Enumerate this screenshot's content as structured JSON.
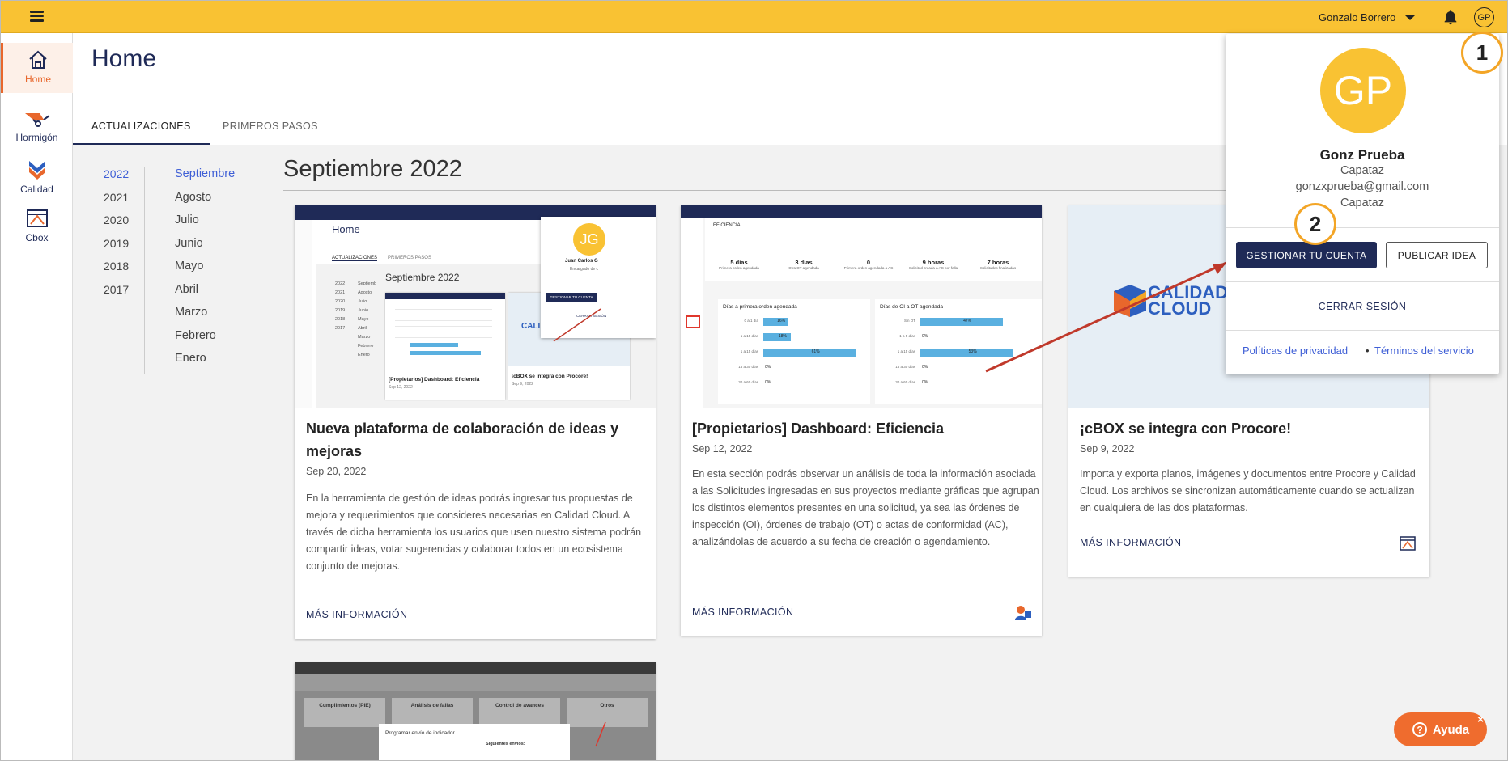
{
  "topbar": {
    "user_name": "Gonzalo Borrero",
    "avatar_initials": "GP",
    "accent": "#f9c233"
  },
  "sidebar": {
    "items": [
      {
        "label": "Home"
      },
      {
        "label": "Hormigón"
      },
      {
        "label": "Calidad"
      },
      {
        "label": "Cbox"
      }
    ]
  },
  "page": {
    "title": "Home",
    "tabs": [
      "ACTUALIZACIONES",
      "PRIMEROS PASOS"
    ]
  },
  "filters": {
    "years": [
      "2022",
      "2021",
      "2020",
      "2019",
      "2018",
      "2017"
    ],
    "months": [
      "Septiembre",
      "Agosto",
      "Julio",
      "Junio",
      "Mayo",
      "Abril",
      "Marzo",
      "Febrero",
      "Enero"
    ]
  },
  "section_title": "Septiembre 2022",
  "cards": [
    {
      "title": "Nueva plataforma de colaboración de ideas y mejoras",
      "date": "Sep 20, 2022",
      "body": "En la herramienta de gestión de ideas podrás ingresar tus propuestas de mejora y requerimientos que consideres necesarias en Calidad Cloud. A través de dicha herramienta los usuarios que usen nuestro sistema podrán compartir ideas, votar sugerencias y colaborar todos en un ecosistema conjunto de mejoras.",
      "more": "MÁS INFORMACIÓN"
    },
    {
      "title": "[Propietarios] Dashboard: Eficiencia",
      "date": "Sep 12, 2022",
      "body": "En esta sección podrás observar un análisis de toda la información asociada a las Solicitudes ingresadas en sus proyectos mediante gráficas que agrupan los distintos elementos presentes en una solicitud, ya sea las órdenes de inspección (OI), órdenes de trabajo (OT) o actas de conformidad (AC), analizándolas de acuerdo a su fecha de creación o agendamiento.",
      "more": "MÁS INFORMACIÓN"
    },
    {
      "title": "¡cBOX se integra con Procore!",
      "date": "Sep 9, 2022",
      "body": "Importa y exporta planos, imágenes y documentos entre Procore y Calidad Cloud. Los archivos se sincronizan automáticamente cuando se actualizan en cualquiera de las dos plataformas.",
      "more": "MÁS INFORMACIÓN"
    }
  ],
  "thumbs": {
    "t1": {
      "title": "Home",
      "tab1": "ACTUALIZACIONES",
      "tab2": "PRIMEROS PASOS",
      "section": "Septiembre 2022",
      "avatar": "JG",
      "user": "Juan Carlos G",
      "role": "Encargado de c",
      "manage": "GESTIONAR TU CUENTA",
      "logout": "CERRAR SESIÓN",
      "card1": "[Propietarios] Dashboard: Eficiencia",
      "card1_date": "Sep 12, 2022",
      "card2": "¡cBOX se integra con Procore!",
      "card2_date": "Sep 9, 2022",
      "logo": "CALIDAD CLOUD",
      "years": [
        "2022",
        "2021",
        "2020",
        "2019",
        "2018",
        "2017"
      ],
      "months": [
        "Septiemb",
        "Agosto",
        "Julio",
        "Junio",
        "Mayo",
        "Abril",
        "Marzo",
        "Febrero",
        "Enero"
      ]
    },
    "t2": {
      "tab": "EFICIENCIA",
      "kpis": [
        {
          "v": "5 días",
          "l": "Primera orden agendada"
        },
        {
          "v": "3 días",
          "l": "Otra OT agendada"
        },
        {
          "v": "0",
          "l": "Primera orden agendada a AC"
        },
        {
          "v": "9 horas",
          "l": "Solicitud creada a AC por falla"
        },
        {
          "v": "7 horas",
          "l": "Solicitudes finalizadas"
        }
      ],
      "chart1": "Días a primera orden agendada",
      "chart2": "Días de OI a OT agendada",
      "bars1": [
        {
          "l": "0 a 1 día",
          "p": "16%",
          "v": 16
        },
        {
          "l": "1 a 15 días",
          "p": "18%",
          "v": 18
        },
        {
          "l": "1 a 15 días",
          "p": "61%",
          "v": 61
        },
        {
          "l": "15 a 30 días",
          "p": "0%",
          "v": 0
        },
        {
          "l": "30 a 60 días",
          "p": "0%",
          "v": 0
        }
      ],
      "bars2": [
        {
          "l": "Sin OT",
          "p": "47%",
          "v": 47
        },
        {
          "l": "1 a 5 días",
          "p": "0%",
          "v": 0
        },
        {
          "l": "1 a 15 días",
          "p": "53%",
          "v": 53
        },
        {
          "l": "15 a 30 días",
          "p": "0%",
          "v": 0
        },
        {
          "l": "30 a 60 días",
          "p": "0%",
          "v": 0
        }
      ]
    },
    "t3": {
      "logo1": "CALIDAD",
      "logo2": "CLOUD"
    },
    "t4": {
      "cells": [
        "Cumplimientos (PIE)",
        "Análisis de fallas",
        "Control de avances",
        "Otros"
      ],
      "modal_title": "Programar envío de indicador",
      "next": "Siguientes envíos:"
    }
  },
  "popup": {
    "initials": "GP",
    "name": "Gonz Prueba",
    "role": "Capataz",
    "email": "gonzxprueba@gmail.com",
    "role2": "Capataz",
    "manage_label": "GESTIONAR TU CUENTA",
    "idea_label": "PUBLICAR IDEA",
    "logout_label": "CERRAR SESIÓN",
    "privacy": "Políticas de privacidad",
    "dot": "•",
    "terms": "Términos del servicio"
  },
  "steps": [
    "1",
    "2"
  ],
  "help": {
    "label": "Ayuda",
    "close": "×"
  }
}
